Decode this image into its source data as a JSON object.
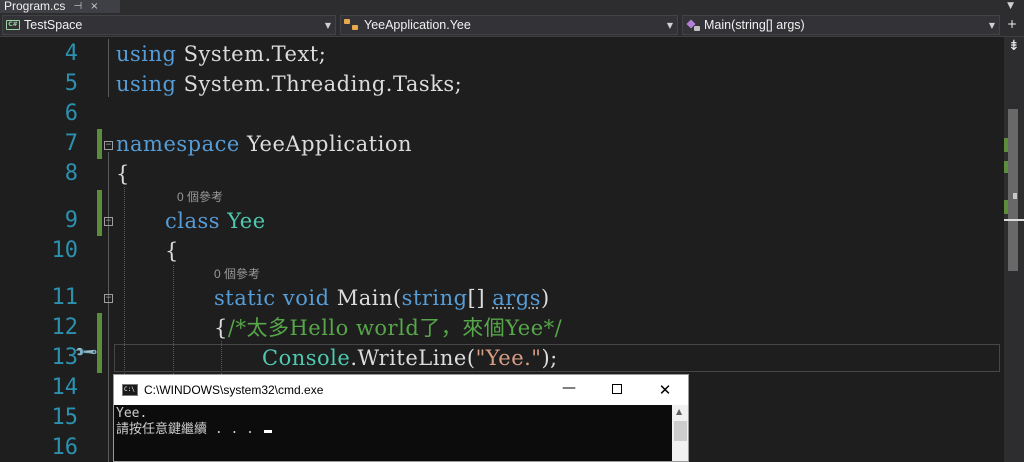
{
  "tab": {
    "label": "Program.cs",
    "pin_glyph": "⊣",
    "close_glyph": "×",
    "overflow_glyph": "▼"
  },
  "navbar": {
    "project": "TestSpace",
    "type": "YeeApplication.Yee",
    "member": "Main(string[] args)",
    "arrow": "▼",
    "split_glyph": "+"
  },
  "editor": {
    "line_numbers": [
      "4",
      "5",
      "6",
      "7",
      "8",
      "9",
      "10",
      "11",
      "12",
      "13",
      "14",
      "15",
      "16"
    ],
    "codelens_class": "0 個參考",
    "codelens_method": "0 個參考",
    "tokens": {
      "l4_kw": "using",
      "l4_ns": " System.Text;",
      "l5_kw": "using",
      "l5_ns": " System.Threading.Tasks;",
      "l7_kw": "namespace",
      "l7_ns": " YeeApplication",
      "l8_brace": "{",
      "l9_kw": "class",
      "l9_ty": "Yee",
      "l10_brace": "{",
      "l11_kw1": "static",
      "l11_kw2": "void",
      "l11_name": "Main(",
      "l11_kw3": "string",
      "l11_rest": "[] ",
      "l11_param": "args",
      "l11_close": ")",
      "l12_brace": "{",
      "l12_comment": "/*太多Hello world了，來個Yee*/",
      "l13_ty": "Console",
      "l13_dot": ".WriteLine(",
      "l13_str": "\"Yee.\"",
      "l13_end": ");"
    }
  },
  "cmd": {
    "title": "C:\\WINDOWS\\system32\\cmd.exe",
    "icon_text": "C:\\",
    "minimize": "—",
    "close": "✕",
    "output_lines": [
      "Yee.",
      "請按任意鍵繼續 . . . "
    ]
  },
  "colors": {
    "keyword": "#569cd6",
    "type": "#4ec9b0",
    "comment": "#57a64a",
    "string": "#d69d85",
    "line_number": "#2b91af",
    "change_bar": "#5c8d3a"
  }
}
